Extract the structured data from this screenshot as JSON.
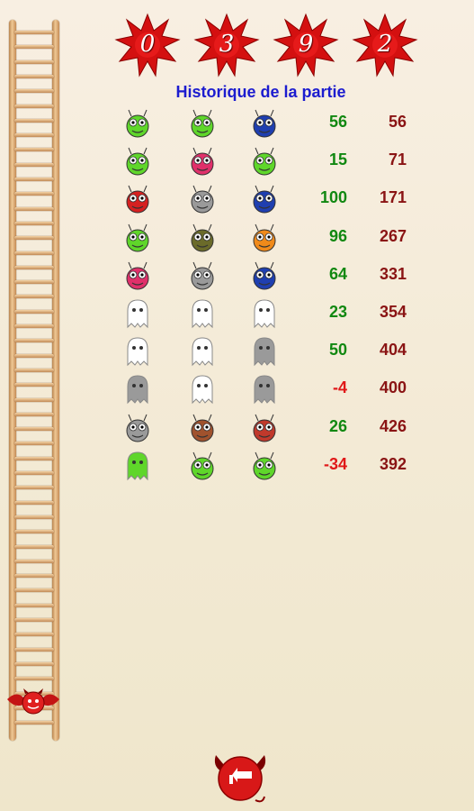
{
  "score": {
    "digits": [
      "0",
      "3",
      "9",
      "2"
    ]
  },
  "title": "Historique de la partie",
  "colors": {
    "positive": "#118811",
    "negative": "#e01818",
    "total": "#8a1414",
    "title": "#1c1ccf"
  },
  "rows": [
    {
      "monsters": [
        "green-alien-monster-icon",
        "green-smiley-alien-icon",
        "blue-spiky-monster-icon"
      ],
      "points": "56",
      "total": "56"
    },
    {
      "monsters": [
        "green-smiley-alien-icon",
        "pink-fairy-icon",
        "green-alien-monster-icon"
      ],
      "points": "15",
      "total": "71"
    },
    {
      "monsters": [
        "red-blob-monster-icon",
        "grey-alien-icon",
        "blue-spiky-monster-icon"
      ],
      "points": "100",
      "total": "171"
    },
    {
      "monsters": [
        "green-alien-icon",
        "olive-alien-icon",
        "orange-one-eye-monster-icon"
      ],
      "points": "96",
      "total": "267"
    },
    {
      "monsters": [
        "pink-spotted-monster-icon",
        "grey-alien-icon",
        "blue-robot-alien-icon"
      ],
      "points": "64",
      "total": "331"
    },
    {
      "monsters": [
        "white-ghost-icon",
        "white-ghost-icon",
        "white-ghost-red-icon"
      ],
      "points": "23",
      "total": "354"
    },
    {
      "monsters": [
        "white-ghost-icon",
        "outline-ghost-icon",
        "ghost-with-box-icon"
      ],
      "points": "50",
      "total": "404"
    },
    {
      "monsters": [
        "grey-skull-ghost-icon",
        "white-ghost-icon",
        "grey-ghost-icon"
      ],
      "points": "-4",
      "total": "400"
    },
    {
      "monsters": [
        "grey-werewolf-icon",
        "brown-tree-monster-icon",
        "vampire-icon"
      ],
      "points": "26",
      "total": "426"
    },
    {
      "monsters": [
        "green-slime-ghost-icon",
        "green-zombie-icon",
        "green-dragon-icon"
      ],
      "points": "-34",
      "total": "392"
    }
  ]
}
